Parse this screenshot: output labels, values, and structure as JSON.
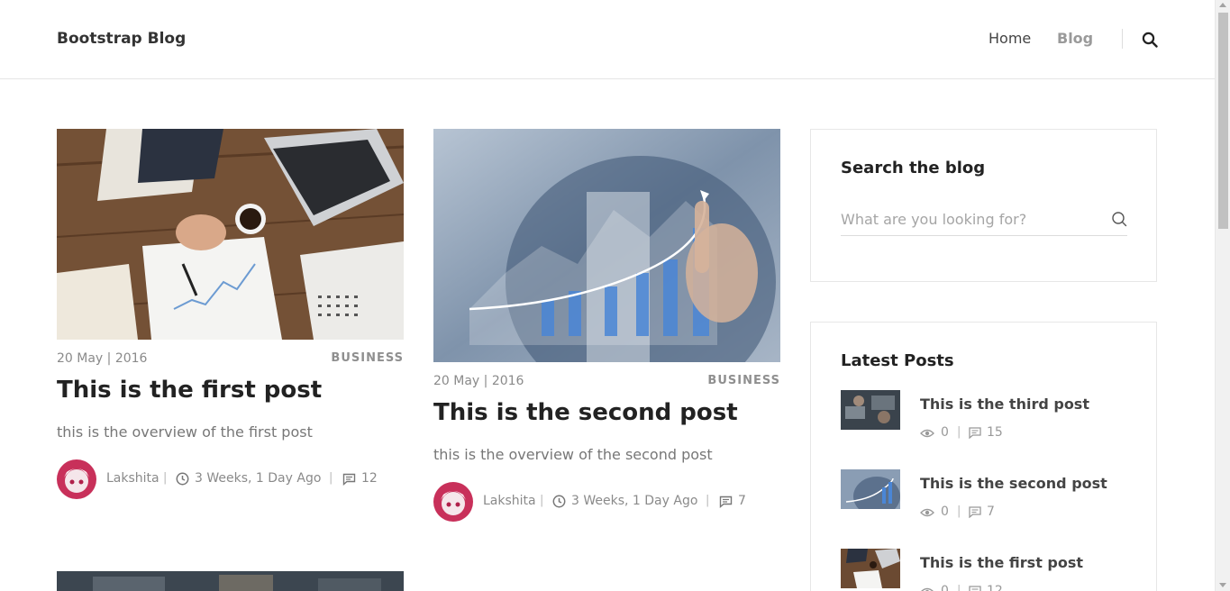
{
  "navbar": {
    "brand": "Bootstrap Blog",
    "links": [
      {
        "label": "Home",
        "active": false
      },
      {
        "label": "Blog",
        "active": true
      }
    ],
    "search_icon": "search-icon"
  },
  "posts": [
    {
      "date": "20 May | 2016",
      "category": "BUSINESS",
      "title": "This is the first post",
      "excerpt": "this is the overview of the first post",
      "author": "Lakshita",
      "time": "3 Weeks, 1 Day Ago",
      "comments": "12"
    },
    {
      "date": "20 May | 2016",
      "category": "BUSINESS",
      "title": "This is the second post",
      "excerpt": "this is the overview of the second post",
      "author": "Lakshita",
      "time": "3 Weeks, 1 Day Ago",
      "comments": "7"
    }
  ],
  "sidebar": {
    "search": {
      "title": "Search the blog",
      "placeholder": "What are you looking for?"
    },
    "latest": {
      "title": "Latest Posts",
      "items": [
        {
          "title": "This is the third post",
          "views": "0",
          "comments": "15"
        },
        {
          "title": "This is the second post",
          "views": "0",
          "comments": "7"
        },
        {
          "title": "This is the first post",
          "views": "0",
          "comments": "12"
        }
      ]
    }
  },
  "separator": "|",
  "colors": {
    "text_dark": "#222222",
    "text_muted": "#8a8a8a",
    "nav_active": "#9a9a9a",
    "border": "#e7e7e7"
  }
}
